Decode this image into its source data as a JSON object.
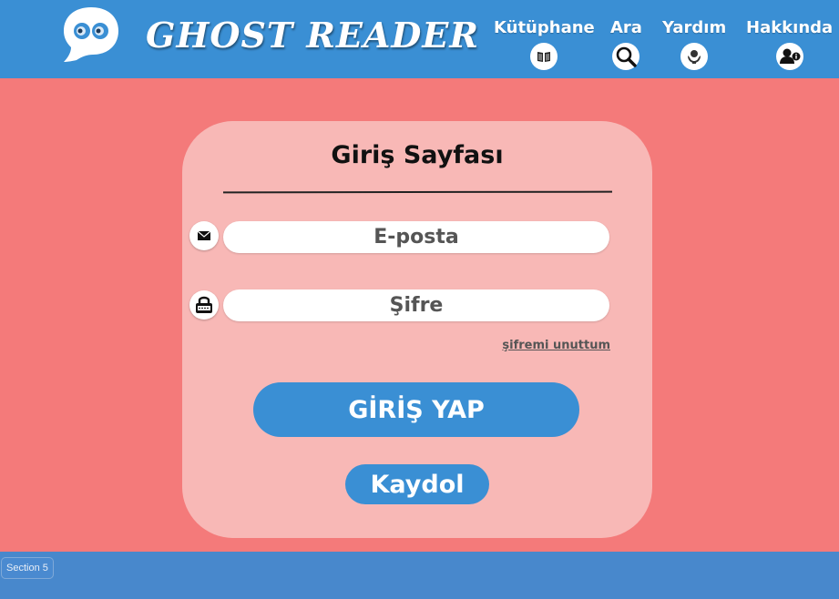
{
  "header": {
    "brand": "GHOST READER",
    "nav": [
      {
        "label": "Kütüphane",
        "icon": "library-icon"
      },
      {
        "label": "Ara",
        "icon": "search-icon"
      },
      {
        "label": "Yardım",
        "icon": "help-hands-icon"
      },
      {
        "label": "Hakkında",
        "icon": "user-info-icon"
      }
    ]
  },
  "login": {
    "title": "Giriş Sayfası",
    "email_placeholder": "E-posta",
    "password_placeholder": "Şifre",
    "forgot_label": "şifremi unuttum",
    "login_label": "GİRİŞ YAP",
    "register_label": "Kaydol"
  },
  "footer": {
    "section_label": "Section 5"
  },
  "colors": {
    "header_blue": "#3a8fd4",
    "background": "#f47a7a",
    "card": "#f8b8b6",
    "footer_blue": "#4888cc"
  }
}
